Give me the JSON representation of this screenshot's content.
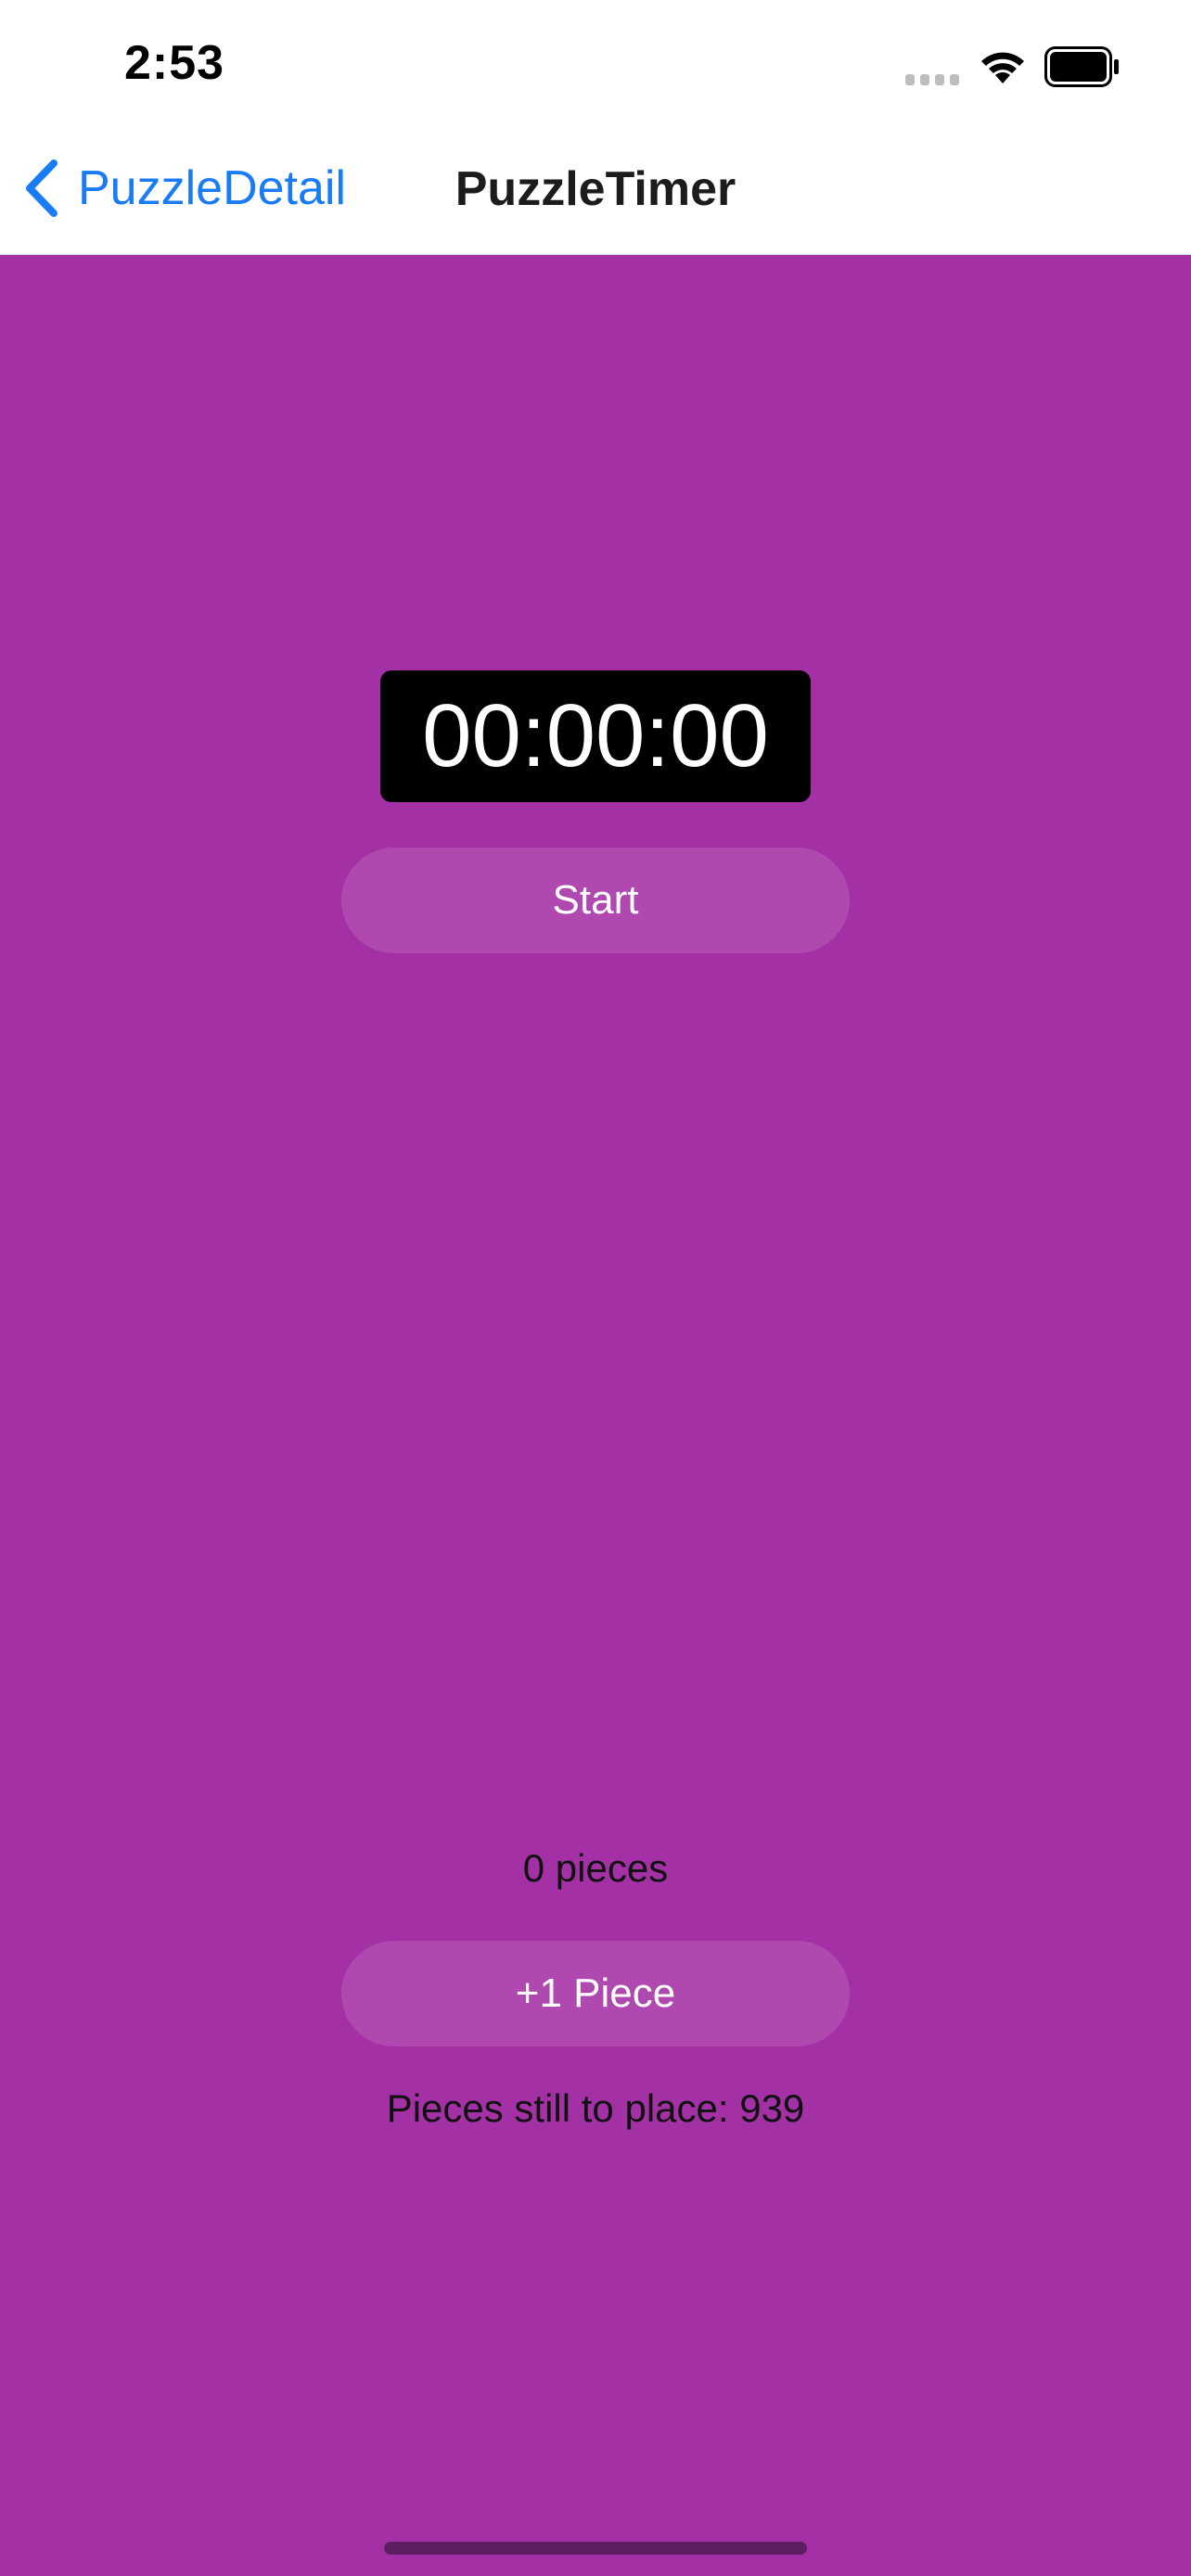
{
  "status_bar": {
    "time": "2:53",
    "icons": [
      "signal-icon",
      "wifi-icon",
      "battery-icon"
    ]
  },
  "nav": {
    "back_label": "PuzzleDetail",
    "title": "PuzzleTimer",
    "back_icon": "chevron-left-icon",
    "accent_color": "#1a7cf5"
  },
  "timer": {
    "display": "00:00:00",
    "start_label": "Start"
  },
  "pieces": {
    "count_text": "0 pieces",
    "add_label": "+1 Piece",
    "remaining_text": "Pieces still to place: 939"
  },
  "colors": {
    "background": "#a430a6",
    "timer_background": "#000000"
  }
}
